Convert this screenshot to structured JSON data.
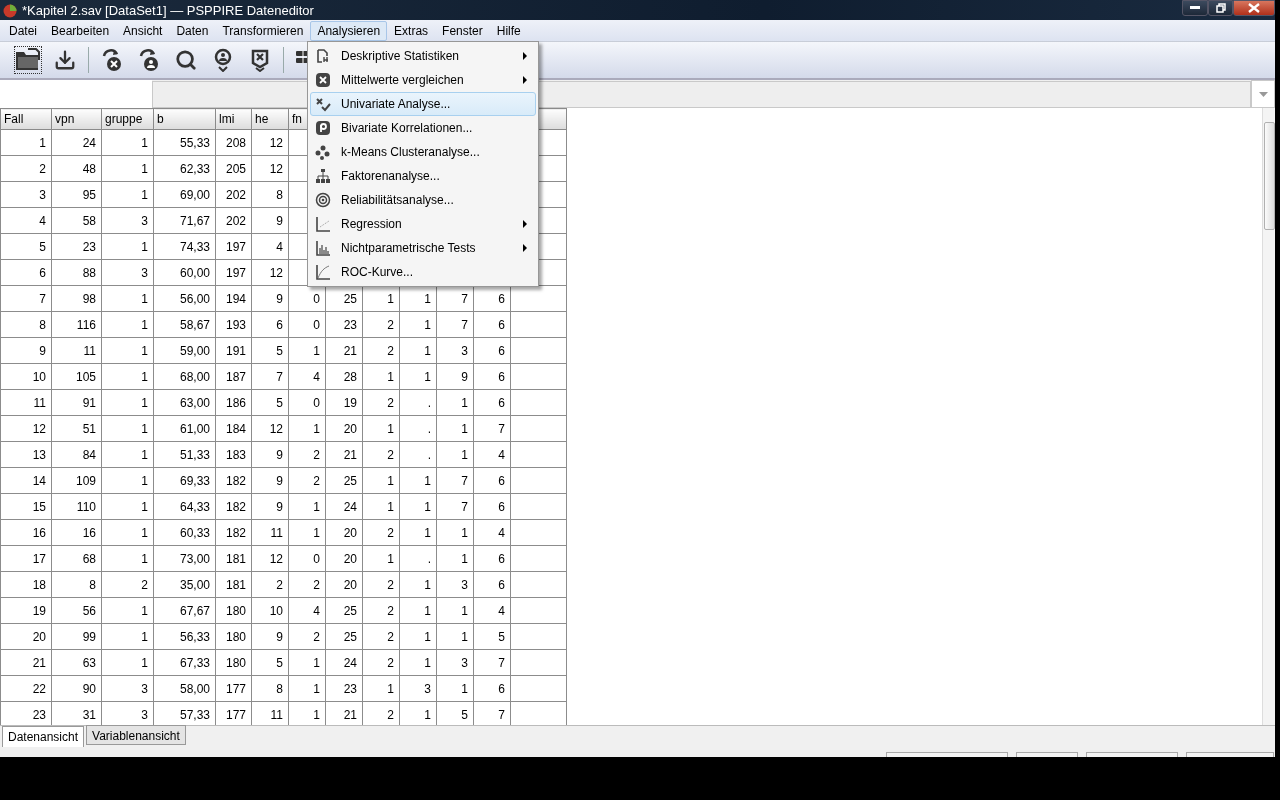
{
  "window": {
    "title": "*Kapitel 2.sav [DataSet1] — PSPPIRE Dateneditor"
  },
  "menu_bar": [
    {
      "label": "Datei",
      "selected": false
    },
    {
      "label": "Bearbeiten",
      "selected": false
    },
    {
      "label": "Ansicht",
      "selected": false
    },
    {
      "label": "Daten",
      "selected": false
    },
    {
      "label": "Transformieren",
      "selected": false
    },
    {
      "label": "Analysieren",
      "selected": true
    },
    {
      "label": "Extras",
      "selected": false
    },
    {
      "label": "Fenster",
      "selected": false
    },
    {
      "label": "Hilfe",
      "selected": false
    }
  ],
  "analyze_menu": [
    {
      "label": "Deskriptive Statistiken",
      "submenu": true,
      "selected": false
    },
    {
      "label": "Mittelwerte vergleichen",
      "submenu": true,
      "selected": false
    },
    {
      "label": "Univariate Analyse...",
      "submenu": false,
      "selected": true
    },
    {
      "label": "Bivariate Korrelationen...",
      "submenu": false,
      "selected": false
    },
    {
      "label": "k-Means Clusteranalyse...",
      "submenu": false,
      "selected": false
    },
    {
      "label": "Faktorenanalyse...",
      "submenu": false,
      "selected": false
    },
    {
      "label": "Reliabilitätsanalyse...",
      "submenu": false,
      "selected": false
    },
    {
      "label": "Regression",
      "submenu": true,
      "selected": false
    },
    {
      "label": "Nichtparametrische Tests",
      "submenu": true,
      "selected": false
    },
    {
      "label": "ROC-Kurve...",
      "submenu": false,
      "selected": false
    }
  ],
  "table": {
    "columns": [
      "Fall",
      "vpn",
      "gruppe",
      "b",
      "lmi",
      "he",
      "fn"
    ],
    "rows": [
      {
        "cells": [
          "1",
          "24",
          "1",
          "55,33",
          "208",
          "12"
        ]
      },
      {
        "cells": [
          "2",
          "48",
          "1",
          "62,33",
          "205",
          "12"
        ]
      },
      {
        "cells": [
          "3",
          "95",
          "1",
          "69,00",
          "202",
          "8"
        ]
      },
      {
        "cells": [
          "4",
          "58",
          "3",
          "71,67",
          "202",
          "9"
        ]
      },
      {
        "cells": [
          "5",
          "23",
          "1",
          "74,33",
          "197",
          "4"
        ]
      },
      {
        "cells": [
          "6",
          "88",
          "3",
          "60,00",
          "197",
          "12"
        ]
      },
      {
        "cells": [
          "7",
          "98",
          "1",
          "56,00",
          "194",
          "9",
          "0",
          "25",
          "1",
          "1",
          "7",
          "6"
        ]
      },
      {
        "cells": [
          "8",
          "116",
          "1",
          "58,67",
          "193",
          "6",
          "0",
          "23",
          "2",
          "1",
          "7",
          "6"
        ]
      },
      {
        "cells": [
          "9",
          "11",
          "1",
          "59,00",
          "191",
          "5",
          "1",
          "21",
          "2",
          "1",
          "3",
          "6"
        ]
      },
      {
        "cells": [
          "10",
          "105",
          "1",
          "68,00",
          "187",
          "7",
          "4",
          "28",
          "1",
          "1",
          "9",
          "6"
        ]
      },
      {
        "cells": [
          "11",
          "91",
          "1",
          "63,00",
          "186",
          "5",
          "0",
          "19",
          "2",
          ".",
          "1",
          "6"
        ]
      },
      {
        "cells": [
          "12",
          "51",
          "1",
          "61,00",
          "184",
          "12",
          "1",
          "20",
          "1",
          ".",
          "1",
          "7"
        ]
      },
      {
        "cells": [
          "13",
          "84",
          "1",
          "51,33",
          "183",
          "9",
          "2",
          "21",
          "2",
          ".",
          "1",
          "4"
        ]
      },
      {
        "cells": [
          "14",
          "109",
          "1",
          "69,33",
          "182",
          "9",
          "2",
          "25",
          "1",
          "1",
          "7",
          "6"
        ]
      },
      {
        "cells": [
          "15",
          "110",
          "1",
          "64,33",
          "182",
          "9",
          "1",
          "24",
          "1",
          "1",
          "7",
          "6"
        ]
      },
      {
        "cells": [
          "16",
          "16",
          "1",
          "60,33",
          "182",
          "11",
          "1",
          "20",
          "2",
          "1",
          "1",
          "4"
        ]
      },
      {
        "cells": [
          "17",
          "68",
          "1",
          "73,00",
          "181",
          "12",
          "0",
          "20",
          "1",
          ".",
          "1",
          "6"
        ]
      },
      {
        "cells": [
          "18",
          "8",
          "2",
          "35,00",
          "181",
          "2",
          "2",
          "20",
          "2",
          "1",
          "3",
          "6"
        ]
      },
      {
        "cells": [
          "19",
          "56",
          "1",
          "67,67",
          "180",
          "10",
          "4",
          "25",
          "2",
          "1",
          "1",
          "4"
        ]
      },
      {
        "cells": [
          "20",
          "99",
          "1",
          "56,33",
          "180",
          "9",
          "2",
          "25",
          "2",
          "1",
          "1",
          "5"
        ]
      },
      {
        "cells": [
          "21",
          "63",
          "1",
          "67,33",
          "180",
          "5",
          "1",
          "24",
          "2",
          "1",
          "3",
          "7"
        ]
      },
      {
        "cells": [
          "22",
          "90",
          "3",
          "58,00",
          "177",
          "8",
          "1",
          "23",
          "1",
          "3",
          "1",
          "6"
        ]
      },
      {
        "cells": [
          "23",
          "31",
          "3",
          "57,33",
          "177",
          "11",
          "1",
          "21",
          "2",
          "1",
          "5",
          "7"
        ]
      }
    ]
  },
  "view_tabs": [
    {
      "label": "Datenansicht",
      "selected": true
    },
    {
      "label": "Variablenansicht",
      "selected": false
    }
  ]
}
